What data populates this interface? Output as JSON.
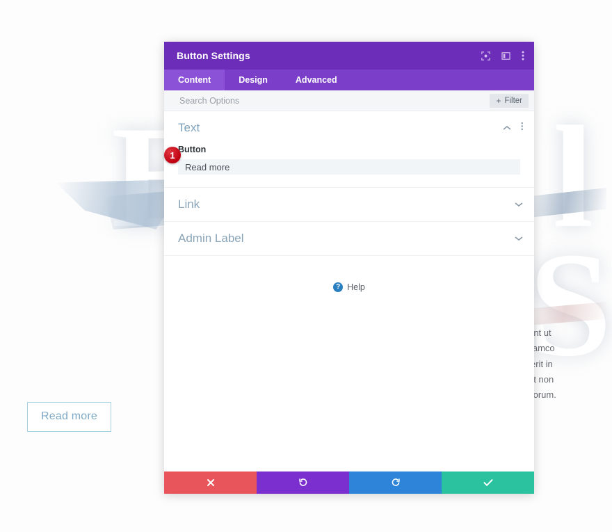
{
  "page": {
    "background_button_label": "Read more",
    "decorative_letters": [
      "B",
      "l",
      "S"
    ],
    "body_text_lines": [
      "mpor incididunt ut",
      "xercitation ullamco",
      "in reprehenderit in",
      "ecat cupidatat non",
      "nim id est laborum."
    ]
  },
  "modal": {
    "title": "Button Settings",
    "header_icons": [
      {
        "name": "fullscreen-icon"
      },
      {
        "name": "layout-columns-icon"
      },
      {
        "name": "vertical-dots-icon"
      }
    ],
    "tabs": [
      {
        "label": "Content",
        "active": true
      },
      {
        "label": "Design",
        "active": false
      },
      {
        "label": "Advanced",
        "active": false
      }
    ],
    "search": {
      "placeholder": "Search Options",
      "value": ""
    },
    "filter_button": {
      "label": "Filter",
      "plus": "+"
    },
    "sections": [
      {
        "title": "Text",
        "expanded": true,
        "field_label": "Button",
        "field_value": "Read more",
        "marker": "1"
      },
      {
        "title": "Link",
        "expanded": false
      },
      {
        "title": "Admin Label",
        "expanded": false
      }
    ],
    "help": {
      "label": "Help",
      "icon_glyph": "?"
    },
    "footer_buttons": [
      {
        "name": "cancel-button",
        "icon": "close-icon",
        "color": "#e8555a"
      },
      {
        "name": "undo-button",
        "icon": "undo-icon",
        "color": "#7b2fce"
      },
      {
        "name": "redo-button",
        "icon": "redo-icon",
        "color": "#2d84d8"
      },
      {
        "name": "save-button",
        "icon": "check-icon",
        "color": "#2bc2a0"
      }
    ]
  },
  "colors": {
    "header_purple": "#6c2eb9",
    "tabs_purple": "#7b3ec9",
    "tab_active_purple": "#8b51d6",
    "badge_red": "#c7000f",
    "help_blue": "#2a7fc0"
  }
}
